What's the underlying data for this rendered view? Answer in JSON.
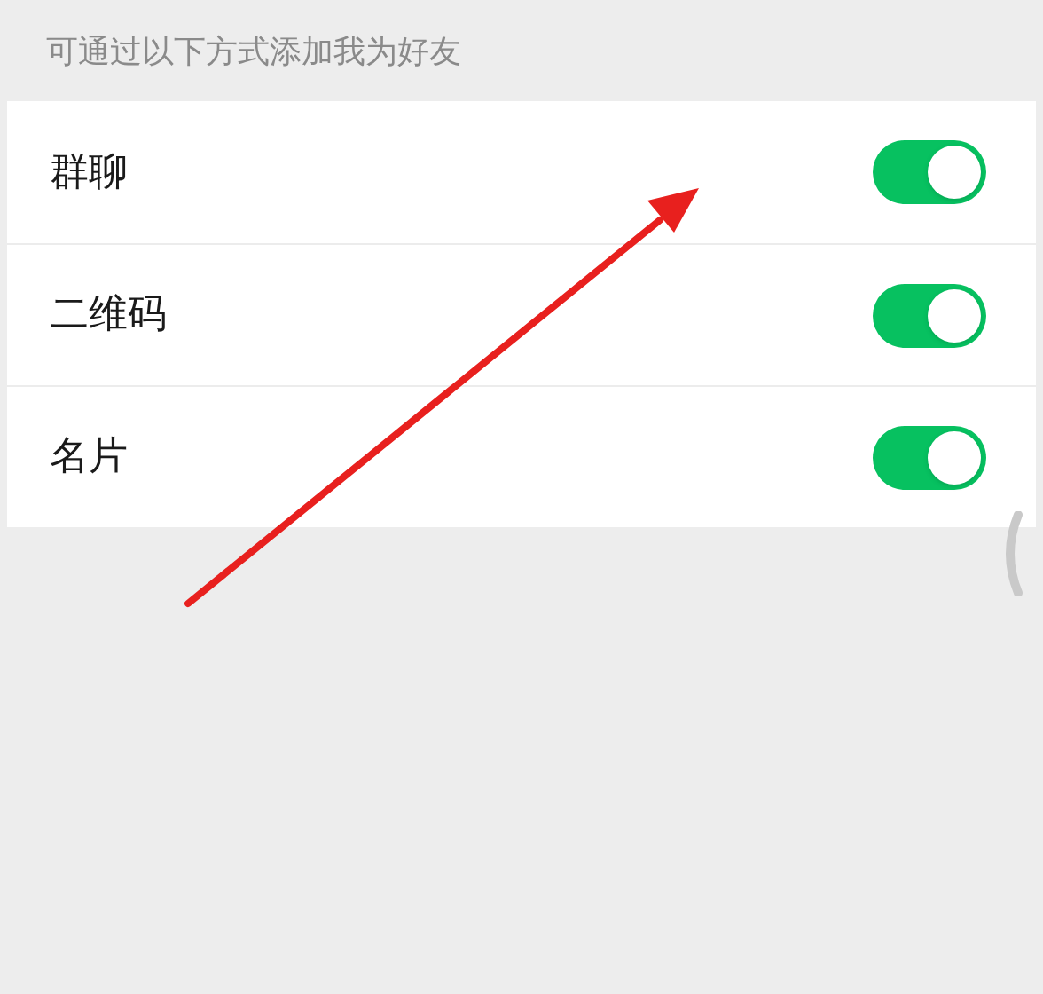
{
  "section_header": "可通过以下方式添加我为好友",
  "rows": [
    {
      "label": "群聊",
      "on": true
    },
    {
      "label": "二维码",
      "on": true
    },
    {
      "label": "名片",
      "on": true
    }
  ]
}
